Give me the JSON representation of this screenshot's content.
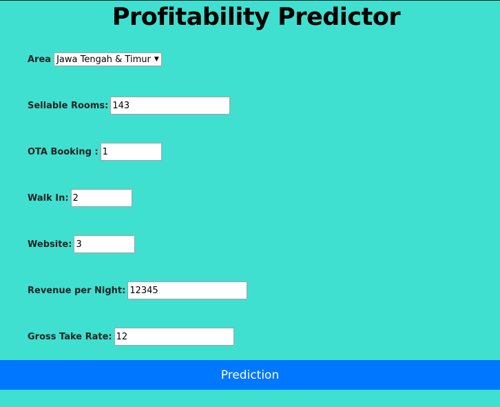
{
  "title": "Profitability Predictor",
  "form": {
    "area": {
      "label": "Area",
      "selected": "Jawa Tengah & Timur"
    },
    "sellable_rooms": {
      "label": "Sellable Rooms:",
      "value": "143"
    },
    "ota_booking": {
      "label": "OTA Booking :",
      "value": "1"
    },
    "walk_in": {
      "label": "Walk In:",
      "value": "2"
    },
    "website": {
      "label": "Website:",
      "value": "3"
    },
    "revenue_per_night": {
      "label": "Revenue per Night:",
      "value": "12345"
    },
    "gross_take_rate": {
      "label": "Gross Take Rate:",
      "value": "12"
    }
  },
  "submit_label": "Prediction",
  "colors": {
    "background": "#40e0d0",
    "button": "#0077ff"
  }
}
